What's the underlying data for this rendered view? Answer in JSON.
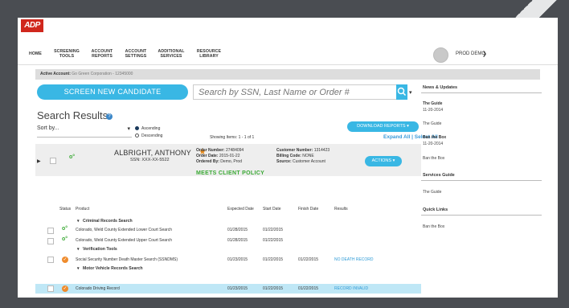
{
  "logo_text": "ADP",
  "nav": [
    {
      "label": "HOME"
    },
    {
      "label": "SCREENING TOOLS"
    },
    {
      "label": "ACCOUNT REPORTS"
    },
    {
      "label": "ACCOUNT SETTINGS"
    },
    {
      "label": "ADDITIONAL SERVICES"
    },
    {
      "label": "RESOURCE LIBRARY"
    }
  ],
  "user": {
    "name": "PROD DEMO"
  },
  "active_account": {
    "label": "Active Account:",
    "value": "Go Green Corporation - 12345000"
  },
  "screen_button": "SCREEN NEW CANDIDATE",
  "search": {
    "placeholder": "Search by SSN, Last Name or Order #"
  },
  "results_title": "Search Results",
  "sort": {
    "label": "Sort by...",
    "asc": "Ascending",
    "desc": "Descending"
  },
  "showing": "Showing Items: 1 - 1 of 1",
  "download_button": "DOWNLOAD REPORTS",
  "expand_links": "Expand All | Select All",
  "candidate": {
    "name": "ALBRIGHT, ANTHONY",
    "ssn": "SSN: XXX-XX-5522",
    "order_number_label": "Order Number:",
    "order_number": "27484094",
    "order_date_label": "Order Date:",
    "order_date": "2015-01-22",
    "ordered_by_label": "Ordered By:",
    "ordered_by": "Demo, Prod",
    "customer_number_label": "Customer Number:",
    "customer_number": "1314423",
    "billing_code_label": "Billing Code:",
    "billing_code": "NONE",
    "source_label": "Source:",
    "source": "Customer Account",
    "policy": "MEETS CLIENT POLICY",
    "actions_button": "ACTIONS"
  },
  "table": {
    "headers": {
      "status": "Status",
      "product": "Product",
      "expected": "Expected Date",
      "start": "Start Date",
      "finish": "Finish Date",
      "results": "Results"
    },
    "groups": [
      "Criminal Records Search",
      "Verification Tools",
      "Motor Vehicle Records Search"
    ],
    "rows": [
      {
        "product": "Colorado, Weld County Extended Lower Court Search",
        "expected": "01/28/2015",
        "start": "01/22/2015",
        "finish": "",
        "result": ""
      },
      {
        "product": "Colorado, Weld County Extended Upper Court Search",
        "expected": "01/28/2015",
        "start": "01/22/2015",
        "finish": "",
        "result": ""
      },
      {
        "product": "Social Security Number Death Master Search (SSNDMS)",
        "expected": "01/23/2015",
        "start": "01/22/2015",
        "finish": "01/22/2015",
        "result": "NO DEATH RECORD"
      },
      {
        "product": "Colorado Driving Record",
        "expected": "01/23/2015",
        "start": "01/22/2015",
        "finish": "01/22/2015",
        "result": "RECORD INVALID"
      }
    ]
  },
  "sidebar": {
    "news_title": "News & Updates",
    "news_items": [
      {
        "title": "The Guide",
        "date": "11-20-2014"
      },
      {
        "title": "The Guide",
        "date": ""
      },
      {
        "title": "Ban the Box",
        "date": "11-20-2014"
      },
      {
        "title": "Ban the Box",
        "date": ""
      }
    ],
    "services_title": "Services Guide",
    "services_items": [
      "The Guide"
    ],
    "quick_title": "Quick Links",
    "quick_items": [
      "Ban the Box"
    ]
  },
  "colors": {
    "accent": "#39b7e4",
    "brand_red": "#d0271d",
    "status_green": "#3aa934",
    "status_orange": "#ef8b2c",
    "link": "#2d9ad6"
  }
}
